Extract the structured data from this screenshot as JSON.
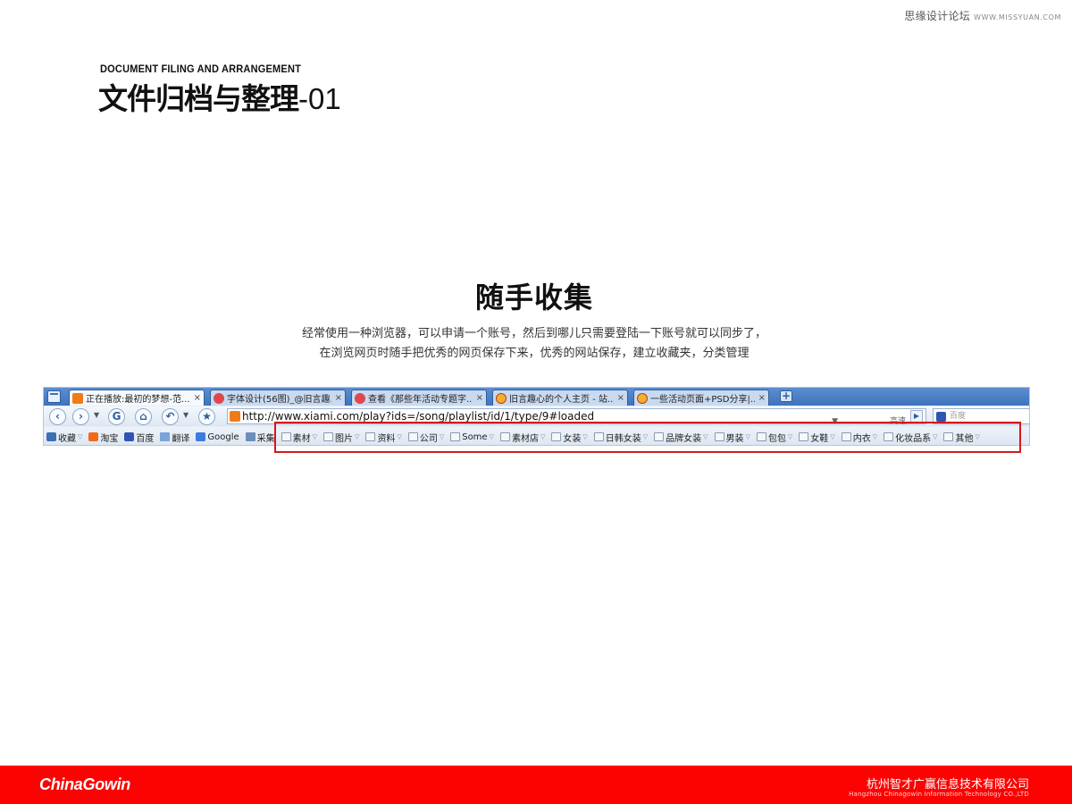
{
  "watermark": {
    "cn": "思缘设计论坛",
    "en": "WWW.MISSYUAN.COM"
  },
  "header": {
    "title_en": "DOCUMENT FILING AND ARRANGEMENT",
    "title_cn": "文件归档与整理",
    "title_num": "-01"
  },
  "section": {
    "title": "随手收集",
    "desc_line1": "经常使用一种浏览器，可以申请一个账号，然后到哪儿只需要登陆一下账号就可以同步了，",
    "desc_line2": "在浏览网页时随手把优秀的网页保存下来，优秀的网站保存，建立收藏夹，分类管理"
  },
  "browser": {
    "tabs": [
      {
        "label": "正在播放:最初的梦想-范...",
        "favicon": "xiami-icon",
        "close": "×"
      },
      {
        "label": "字体设计(56图)_@旧言趣...",
        "favicon": "rose-icon",
        "close": "×"
      },
      {
        "label": "查看《那些年活动专题字...",
        "favicon": "rose-icon",
        "close": "×"
      },
      {
        "label": "旧言趣心的个人主页 - 站...",
        "favicon": "zcool-icon",
        "close": "×"
      },
      {
        "label": "一些活动页面+PSD分享|...",
        "favicon": "zcool-icon",
        "close": "×"
      }
    ],
    "new_tab": "+",
    "nav": {
      "back": "‹",
      "forward": "›",
      "refresh": "G",
      "home": "⌂",
      "undo": "↶",
      "favorite": "★"
    },
    "address": {
      "url": "http://www.xiami.com/play?ids=/song/playlist/id/1/type/9#loaded",
      "speed_label": "高速",
      "go": "▶"
    },
    "search": {
      "placeholder": "百度"
    },
    "bookmarks": [
      {
        "label": "收藏",
        "icon": "star-icon",
        "dropdown": true
      },
      {
        "label": "淘宝",
        "icon": "taobao-icon",
        "dropdown": false
      },
      {
        "label": "百度",
        "icon": "baidu-icon",
        "dropdown": false
      },
      {
        "label": "翻译",
        "icon": "translate-icon",
        "dropdown": false
      },
      {
        "label": "Google",
        "icon": "google-icon",
        "dropdown": false
      },
      {
        "label": "采集",
        "icon": "collect-icon",
        "dropdown": false
      },
      {
        "label": "素材",
        "icon": "folder-icon",
        "dropdown": true
      },
      {
        "label": "图片",
        "icon": "folder-icon",
        "dropdown": true
      },
      {
        "label": "资料",
        "icon": "folder-icon",
        "dropdown": true
      },
      {
        "label": "公司",
        "icon": "folder-icon",
        "dropdown": true
      },
      {
        "label": "Some",
        "icon": "folder-icon",
        "dropdown": true
      },
      {
        "label": "素材店",
        "icon": "folder-icon",
        "dropdown": true
      },
      {
        "label": "女装",
        "icon": "folder-icon",
        "dropdown": true
      },
      {
        "label": "日韩女装",
        "icon": "folder-icon",
        "dropdown": true
      },
      {
        "label": "品牌女装",
        "icon": "folder-icon",
        "dropdown": true
      },
      {
        "label": "男装",
        "icon": "folder-icon",
        "dropdown": true
      },
      {
        "label": "包包",
        "icon": "folder-icon",
        "dropdown": true
      },
      {
        "label": "女鞋",
        "icon": "folder-icon",
        "dropdown": true
      },
      {
        "label": "内衣",
        "icon": "folder-icon",
        "dropdown": true
      },
      {
        "label": "化妆品系",
        "icon": "folder-icon",
        "dropdown": true
      },
      {
        "label": "其他",
        "icon": "folder-icon",
        "dropdown": true
      }
    ]
  },
  "footer": {
    "brand": "ChinaGowin",
    "company_cn": "杭州智才广赢信息技术有限公司",
    "company_en": "Hangzhou Chinagowin Information Technology CO.,LTD"
  },
  "colors": {
    "footer_bg": "#fd0202",
    "highlight": "#d61818",
    "tabbar": "#3e73bb"
  }
}
